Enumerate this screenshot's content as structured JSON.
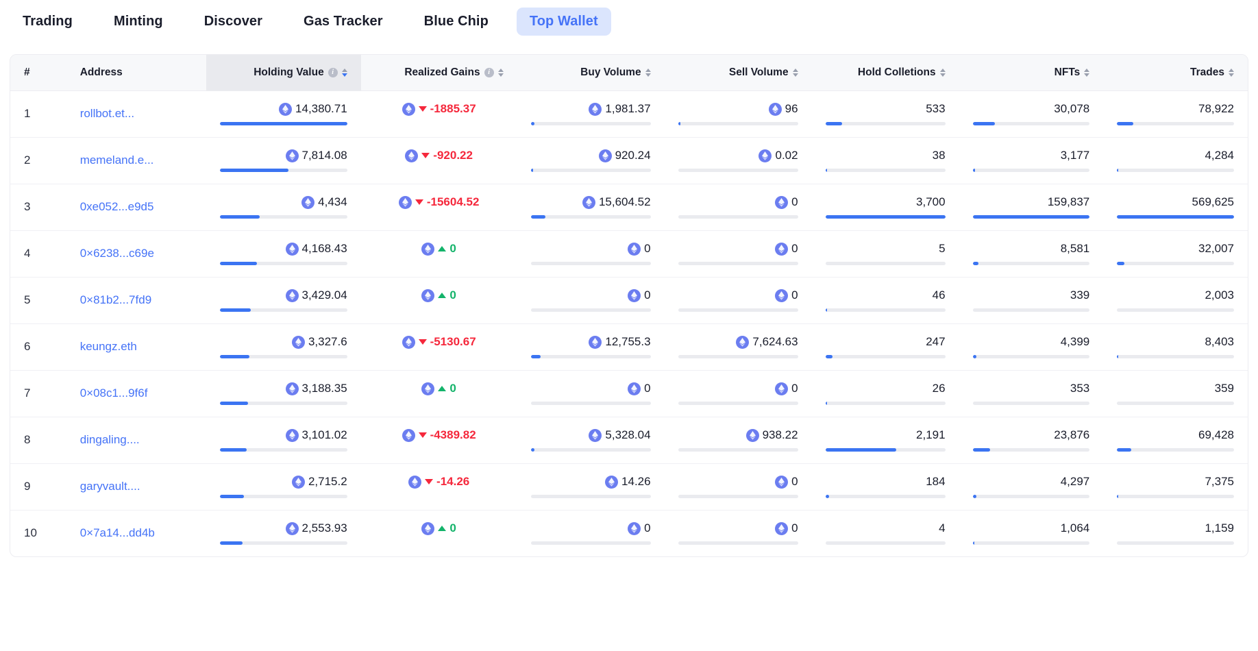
{
  "nav": {
    "tabs": [
      {
        "label": "Trading",
        "active": false
      },
      {
        "label": "Minting",
        "active": false
      },
      {
        "label": "Discover",
        "active": false
      },
      {
        "label": "Gas Tracker",
        "active": false
      },
      {
        "label": "Blue Chip",
        "active": false
      },
      {
        "label": "Top Wallet",
        "active": true
      }
    ]
  },
  "colors": {
    "accent": "#4573f7",
    "bar_fill": "#3b74f2",
    "bar_track": "#eaebef",
    "negative": "#f5283c",
    "positive": "#13b36a",
    "eth_token": "#6b7df0",
    "active_tab_bg": "#dbe5fd",
    "header_bg": "#f7f8fa",
    "sorted_header_bg": "#e9eaee"
  },
  "table": {
    "columns": [
      {
        "key": "rank",
        "label": "#",
        "align": "left",
        "info": false,
        "sorter": false,
        "sorted": false
      },
      {
        "key": "addr",
        "label": "Address",
        "align": "left",
        "info": false,
        "sorter": false,
        "sorted": false
      },
      {
        "key": "hold",
        "label": "Holding Value",
        "align": "right",
        "info": true,
        "sorter": true,
        "sorted": true
      },
      {
        "key": "gain",
        "label": "Realized Gains",
        "align": "right",
        "info": true,
        "sorter": true,
        "sorted": false
      },
      {
        "key": "buy",
        "label": "Buy Volume",
        "align": "right",
        "info": false,
        "sorter": true,
        "sorted": false
      },
      {
        "key": "sell",
        "label": "Sell Volume",
        "align": "right",
        "info": false,
        "sorter": true,
        "sorted": false
      },
      {
        "key": "coll",
        "label": "Hold Colletions",
        "align": "right",
        "info": false,
        "sorter": true,
        "sorted": false
      },
      {
        "key": "nfts",
        "label": "NFTs",
        "align": "right",
        "info": false,
        "sorter": true,
        "sorted": false
      },
      {
        "key": "trades",
        "label": "Trades",
        "align": "right",
        "info": false,
        "sorter": true,
        "sorted": false
      }
    ],
    "rows": [
      {
        "rank": "1",
        "address": "rollbot.et...",
        "holding_value": "14,380.71",
        "holding_pct": 100,
        "realized_gains": "-1885.37",
        "gains_sign": "negative",
        "buy_volume": "1,981.37",
        "buy_pct": 3,
        "sell_volume": "96",
        "sell_pct": 2,
        "hold_collections": "533",
        "coll_pct": 14,
        "nfts": "30,078",
        "nfts_pct": 19,
        "trades": "78,922",
        "trades_pct": 14
      },
      {
        "rank": "2",
        "address": "memeland.e...",
        "holding_value": "7,814.08",
        "holding_pct": 54,
        "realized_gains": "-920.22",
        "gains_sign": "negative",
        "buy_volume": "920.24",
        "buy_pct": 2,
        "sell_volume": "0.02",
        "sell_pct": 0,
        "hold_collections": "38",
        "coll_pct": 1,
        "nfts": "3,177",
        "nfts_pct": 2,
        "trades": "4,284",
        "trades_pct": 1
      },
      {
        "rank": "3",
        "address": "0xe052...e9d5",
        "holding_value": "4,434",
        "holding_pct": 31,
        "realized_gains": "-15604.52",
        "gains_sign": "negative",
        "buy_volume": "15,604.52",
        "buy_pct": 12,
        "sell_volume": "0",
        "sell_pct": 0,
        "hold_collections": "3,700",
        "coll_pct": 100,
        "nfts": "159,837",
        "nfts_pct": 100,
        "trades": "569,625",
        "trades_pct": 100
      },
      {
        "rank": "4",
        "address": "0×6238...c69e",
        "holding_value": "4,168.43",
        "holding_pct": 29,
        "realized_gains": "0",
        "gains_sign": "positive",
        "buy_volume": "0",
        "buy_pct": 0,
        "sell_volume": "0",
        "sell_pct": 0,
        "hold_collections": "5",
        "coll_pct": 0,
        "nfts": "8,581",
        "nfts_pct": 5,
        "trades": "32,007",
        "trades_pct": 6
      },
      {
        "rank": "5",
        "address": "0×81b2...7fd9",
        "holding_value": "3,429.04",
        "holding_pct": 24,
        "realized_gains": "0",
        "gains_sign": "positive",
        "buy_volume": "0",
        "buy_pct": 0,
        "sell_volume": "0",
        "sell_pct": 0,
        "hold_collections": "46",
        "coll_pct": 1,
        "nfts": "339",
        "nfts_pct": 0,
        "trades": "2,003",
        "trades_pct": 0
      },
      {
        "rank": "6",
        "address": "keungz.eth",
        "holding_value": "3,327.6",
        "holding_pct": 23,
        "realized_gains": "-5130.67",
        "gains_sign": "negative",
        "buy_volume": "12,755.3",
        "buy_pct": 8,
        "sell_volume": "7,624.63",
        "sell_pct": 0,
        "hold_collections": "247",
        "coll_pct": 6,
        "nfts": "4,399",
        "nfts_pct": 3,
        "trades": "8,403",
        "trades_pct": 1
      },
      {
        "rank": "7",
        "address": "0×08c1...9f6f",
        "holding_value": "3,188.35",
        "holding_pct": 22,
        "realized_gains": "0",
        "gains_sign": "positive",
        "buy_volume": "0",
        "buy_pct": 0,
        "sell_volume": "0",
        "sell_pct": 0,
        "hold_collections": "26",
        "coll_pct": 1,
        "nfts": "353",
        "nfts_pct": 0,
        "trades": "359",
        "trades_pct": 0
      },
      {
        "rank": "8",
        "address": "dingaling....",
        "holding_value": "3,101.02",
        "holding_pct": 21,
        "realized_gains": "-4389.82",
        "gains_sign": "negative",
        "buy_volume": "5,328.04",
        "buy_pct": 3,
        "sell_volume": "938.22",
        "sell_pct": 0,
        "hold_collections": "2,191",
        "coll_pct": 59,
        "nfts": "23,876",
        "nfts_pct": 15,
        "trades": "69,428",
        "trades_pct": 12
      },
      {
        "rank": "9",
        "address": "garyvault....",
        "holding_value": "2,715.2",
        "holding_pct": 19,
        "realized_gains": "-14.26",
        "gains_sign": "negative",
        "buy_volume": "14.26",
        "buy_pct": 0,
        "sell_volume": "0",
        "sell_pct": 0,
        "hold_collections": "184",
        "coll_pct": 3,
        "nfts": "4,297",
        "nfts_pct": 3,
        "trades": "7,375",
        "trades_pct": 1
      },
      {
        "rank": "10",
        "address": "0×7a14...dd4b",
        "holding_value": "2,553.93",
        "holding_pct": 18,
        "realized_gains": "0",
        "gains_sign": "positive",
        "buy_volume": "0",
        "buy_pct": 0,
        "sell_volume": "0",
        "sell_pct": 0,
        "hold_collections": "4",
        "coll_pct": 0,
        "nfts": "1,064",
        "nfts_pct": 1,
        "trades": "1,159",
        "trades_pct": 0
      }
    ]
  }
}
